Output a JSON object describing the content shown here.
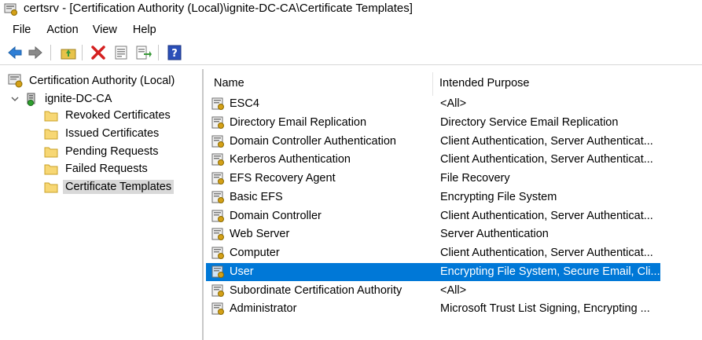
{
  "window": {
    "title": "certsrv - [Certification Authority (Local)\\ignite-DC-CA\\Certificate Templates]"
  },
  "menu": [
    "File",
    "Action",
    "View",
    "Help"
  ],
  "toolbar": {
    "icons": [
      "back-arrow-icon",
      "forward-arrow-icon",
      "up-folder-icon",
      "delete-icon",
      "properties-icon",
      "export-list-icon",
      "help-icon"
    ]
  },
  "tree": {
    "root": "Certification Authority (Local)",
    "ca": "ignite-DC-CA",
    "children": [
      "Revoked Certificates",
      "Issued Certificates",
      "Pending Requests",
      "Failed Requests",
      "Certificate Templates"
    ],
    "selected": "Certificate Templates"
  },
  "list": {
    "columns": [
      "Name",
      "Intended Purpose"
    ],
    "rows": [
      {
        "name": "ESC4",
        "purpose": "<All>"
      },
      {
        "name": "Directory Email Replication",
        "purpose": "Directory Service Email Replication"
      },
      {
        "name": "Domain Controller Authentication",
        "purpose": "Client Authentication, Server Authenticat..."
      },
      {
        "name": "Kerberos Authentication",
        "purpose": "Client Authentication, Server Authenticat..."
      },
      {
        "name": "EFS Recovery Agent",
        "purpose": "File Recovery"
      },
      {
        "name": "Basic EFS",
        "purpose": "Encrypting File System"
      },
      {
        "name": "Domain Controller",
        "purpose": "Client Authentication, Server Authenticat..."
      },
      {
        "name": "Web Server",
        "purpose": "Server Authentication"
      },
      {
        "name": "Computer",
        "purpose": "Client Authentication, Server Authenticat..."
      },
      {
        "name": "User",
        "purpose": "Encrypting File System, Secure Email, Cli..."
      },
      {
        "name": "Subordinate Certification Authority",
        "purpose": "<All>"
      },
      {
        "name": "Administrator",
        "purpose": "Microsoft Trust List Signing, Encrypting ..."
      }
    ],
    "selected": "User"
  },
  "colors": {
    "selection": "#0078d7",
    "tree_selection": "#d9d9d9",
    "folder": "#f7d774"
  }
}
